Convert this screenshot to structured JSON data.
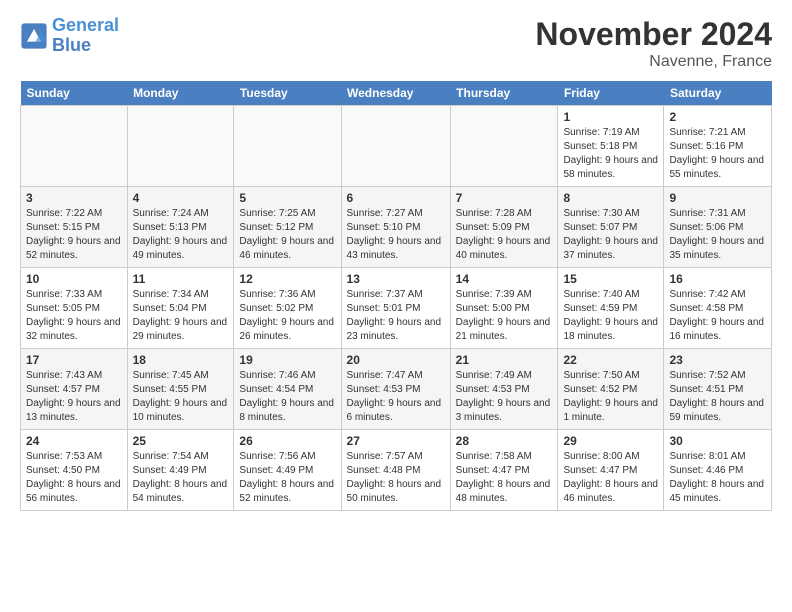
{
  "logo": {
    "line1": "General",
    "line2": "Blue"
  },
  "title": "November 2024",
  "subtitle": "Navenne, France",
  "weekdays": [
    "Sunday",
    "Monday",
    "Tuesday",
    "Wednesday",
    "Thursday",
    "Friday",
    "Saturday"
  ],
  "weeks": [
    [
      {
        "day": "",
        "info": ""
      },
      {
        "day": "",
        "info": ""
      },
      {
        "day": "",
        "info": ""
      },
      {
        "day": "",
        "info": ""
      },
      {
        "day": "",
        "info": ""
      },
      {
        "day": "1",
        "info": "Sunrise: 7:19 AM\nSunset: 5:18 PM\nDaylight: 9 hours and 58 minutes."
      },
      {
        "day": "2",
        "info": "Sunrise: 7:21 AM\nSunset: 5:16 PM\nDaylight: 9 hours and 55 minutes."
      }
    ],
    [
      {
        "day": "3",
        "info": "Sunrise: 7:22 AM\nSunset: 5:15 PM\nDaylight: 9 hours and 52 minutes."
      },
      {
        "day": "4",
        "info": "Sunrise: 7:24 AM\nSunset: 5:13 PM\nDaylight: 9 hours and 49 minutes."
      },
      {
        "day": "5",
        "info": "Sunrise: 7:25 AM\nSunset: 5:12 PM\nDaylight: 9 hours and 46 minutes."
      },
      {
        "day": "6",
        "info": "Sunrise: 7:27 AM\nSunset: 5:10 PM\nDaylight: 9 hours and 43 minutes."
      },
      {
        "day": "7",
        "info": "Sunrise: 7:28 AM\nSunset: 5:09 PM\nDaylight: 9 hours and 40 minutes."
      },
      {
        "day": "8",
        "info": "Sunrise: 7:30 AM\nSunset: 5:07 PM\nDaylight: 9 hours and 37 minutes."
      },
      {
        "day": "9",
        "info": "Sunrise: 7:31 AM\nSunset: 5:06 PM\nDaylight: 9 hours and 35 minutes."
      }
    ],
    [
      {
        "day": "10",
        "info": "Sunrise: 7:33 AM\nSunset: 5:05 PM\nDaylight: 9 hours and 32 minutes."
      },
      {
        "day": "11",
        "info": "Sunrise: 7:34 AM\nSunset: 5:04 PM\nDaylight: 9 hours and 29 minutes."
      },
      {
        "day": "12",
        "info": "Sunrise: 7:36 AM\nSunset: 5:02 PM\nDaylight: 9 hours and 26 minutes."
      },
      {
        "day": "13",
        "info": "Sunrise: 7:37 AM\nSunset: 5:01 PM\nDaylight: 9 hours and 23 minutes."
      },
      {
        "day": "14",
        "info": "Sunrise: 7:39 AM\nSunset: 5:00 PM\nDaylight: 9 hours and 21 minutes."
      },
      {
        "day": "15",
        "info": "Sunrise: 7:40 AM\nSunset: 4:59 PM\nDaylight: 9 hours and 18 minutes."
      },
      {
        "day": "16",
        "info": "Sunrise: 7:42 AM\nSunset: 4:58 PM\nDaylight: 9 hours and 16 minutes."
      }
    ],
    [
      {
        "day": "17",
        "info": "Sunrise: 7:43 AM\nSunset: 4:57 PM\nDaylight: 9 hours and 13 minutes."
      },
      {
        "day": "18",
        "info": "Sunrise: 7:45 AM\nSunset: 4:55 PM\nDaylight: 9 hours and 10 minutes."
      },
      {
        "day": "19",
        "info": "Sunrise: 7:46 AM\nSunset: 4:54 PM\nDaylight: 9 hours and 8 minutes."
      },
      {
        "day": "20",
        "info": "Sunrise: 7:47 AM\nSunset: 4:53 PM\nDaylight: 9 hours and 6 minutes."
      },
      {
        "day": "21",
        "info": "Sunrise: 7:49 AM\nSunset: 4:53 PM\nDaylight: 9 hours and 3 minutes."
      },
      {
        "day": "22",
        "info": "Sunrise: 7:50 AM\nSunset: 4:52 PM\nDaylight: 9 hours and 1 minute."
      },
      {
        "day": "23",
        "info": "Sunrise: 7:52 AM\nSunset: 4:51 PM\nDaylight: 8 hours and 59 minutes."
      }
    ],
    [
      {
        "day": "24",
        "info": "Sunrise: 7:53 AM\nSunset: 4:50 PM\nDaylight: 8 hours and 56 minutes."
      },
      {
        "day": "25",
        "info": "Sunrise: 7:54 AM\nSunset: 4:49 PM\nDaylight: 8 hours and 54 minutes."
      },
      {
        "day": "26",
        "info": "Sunrise: 7:56 AM\nSunset: 4:49 PM\nDaylight: 8 hours and 52 minutes."
      },
      {
        "day": "27",
        "info": "Sunrise: 7:57 AM\nSunset: 4:48 PM\nDaylight: 8 hours and 50 minutes."
      },
      {
        "day": "28",
        "info": "Sunrise: 7:58 AM\nSunset: 4:47 PM\nDaylight: 8 hours and 48 minutes."
      },
      {
        "day": "29",
        "info": "Sunrise: 8:00 AM\nSunset: 4:47 PM\nDaylight: 8 hours and 46 minutes."
      },
      {
        "day": "30",
        "info": "Sunrise: 8:01 AM\nSunset: 4:46 PM\nDaylight: 8 hours and 45 minutes."
      }
    ]
  ]
}
